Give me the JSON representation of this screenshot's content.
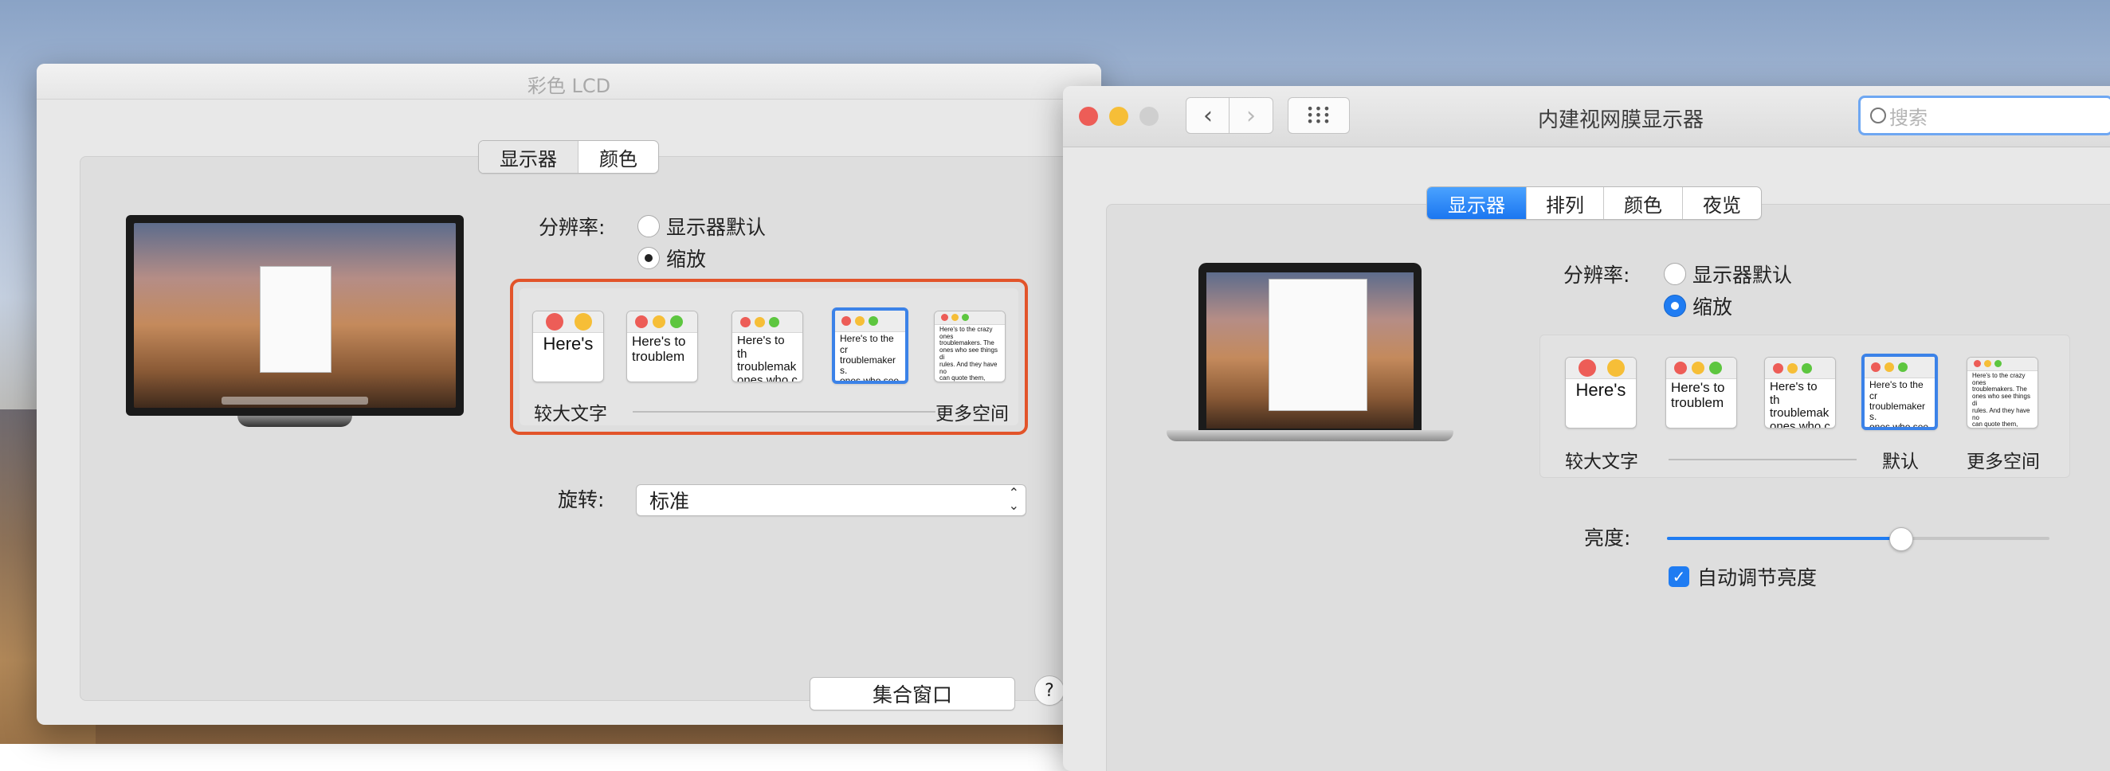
{
  "lcd_window": {
    "title": "彩色 LCD",
    "tabs": [
      "显示器",
      "颜色"
    ],
    "selected_tab": "显示器",
    "resolution_label": "分辨率:",
    "resolution_options": [
      "显示器默认",
      "缩放"
    ],
    "resolution_selected": "缩放",
    "scale_samples": [
      "Here's",
      "Here's to\ntroublem",
      "Here's to th\ntroublemak\nones who c",
      "Here's to the cr\ntroublemakers.\nones who see t\nrules. And they",
      "Here's to the crazy ones\ntroublemakers. The\nones who see things di\nrules. And they have no\ncan quote them, disag\nAbout the only th\nBecause they change"
    ],
    "scale_selected_index": 3,
    "scale_left_label": "较大文字",
    "scale_right_label": "更多空间",
    "rotation_label": "旋转:",
    "rotation_value": "标准",
    "gather_windows_button": "集合窗口",
    "help_button": "?"
  },
  "retina_window": {
    "title": "内建视网膜显示器",
    "search_placeholder": "搜索",
    "tabs": [
      "显示器",
      "排列",
      "颜色",
      "夜览"
    ],
    "selected_tab": "显示器",
    "resolution_label": "分辨率:",
    "resolution_options": [
      "显示器默认",
      "缩放"
    ],
    "resolution_selected": "缩放",
    "scale_samples": [
      "Here's",
      "Here's to\ntroublem",
      "Here's to th\ntroublemak\nones who c",
      "Here's to the cr\ntroublemakers.\nones who see t\nrules. And they",
      "Here's to the crazy ones\ntroublemakers. The\nones who see things di\nrules. And they have no\ncan quote them, disag\nAbout the only th\nBecause they change"
    ],
    "scale_selected_index": 3,
    "scale_left_label": "较大文字",
    "scale_default_label": "默认",
    "scale_right_label": "更多空间",
    "brightness_label": "亮度:",
    "brightness_level": 0.61,
    "auto_brightness_label": "自动调节亮度",
    "auto_brightness_checked": true
  },
  "colors": {
    "accent": "#1f7cf2",
    "highlight": "#e2542a"
  }
}
